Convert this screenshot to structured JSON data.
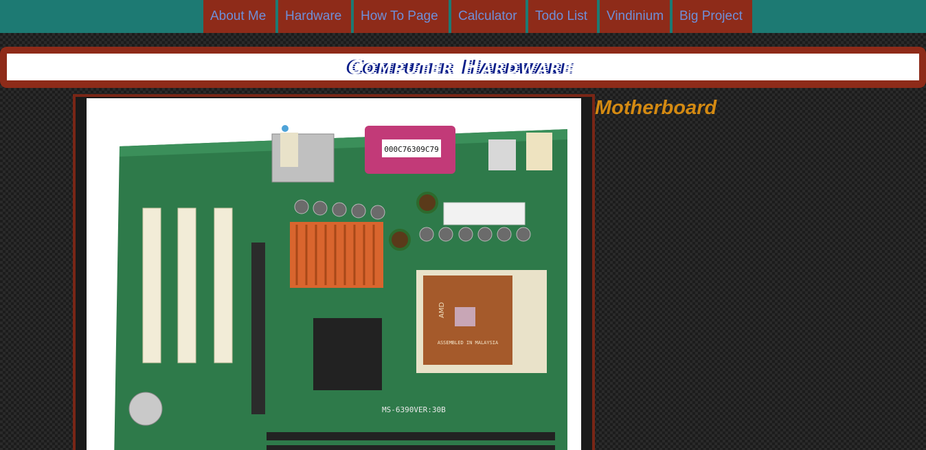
{
  "nav": {
    "items": [
      {
        "label": "About Me"
      },
      {
        "label": "Hardware"
      },
      {
        "label": "How To Page"
      },
      {
        "label": "Calculator"
      },
      {
        "label": "Todo List"
      },
      {
        "label": "Vindinium"
      },
      {
        "label": "Big Project"
      }
    ]
  },
  "banner": {
    "title": "Computer Hardware"
  },
  "main": {
    "section_title": "Motherboard",
    "image": {
      "label": "000C76309C79",
      "board_text": "MS-6390VER:30B",
      "cpu_text": "ASSEMBLED IN MALAYSIA",
      "cpu_brand": "AMD"
    }
  },
  "colors": {
    "nav_bg": "#1d7a73",
    "nav_item_bg": "#8e2b19",
    "nav_text": "#6f8fd8",
    "banner_bg": "#8e2b19",
    "title_text": "#0c1f8a",
    "section_title": "#d48a12"
  }
}
